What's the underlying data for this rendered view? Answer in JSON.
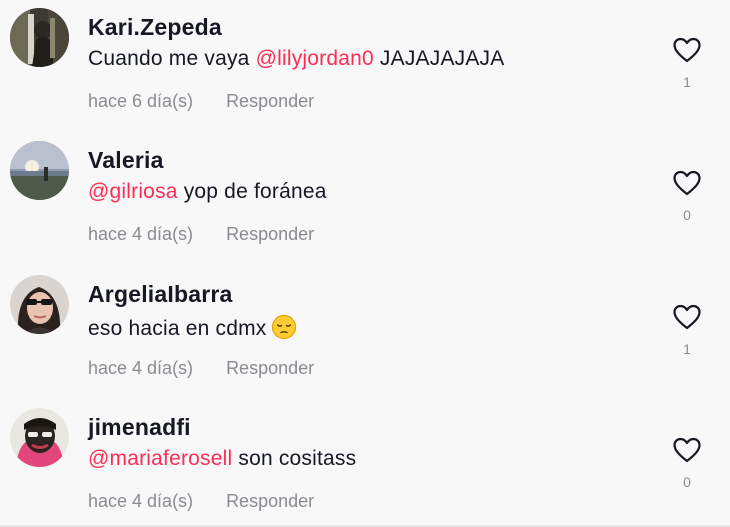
{
  "comments": [
    {
      "username": "Kari.Zepeda",
      "text_before": "Cuando me vaya ",
      "mention": "@lilyjordan0",
      "text_after": " JAJAJAJAJA",
      "time": "hace 6 día(s)",
      "reply_label": "Responder",
      "likes": "1"
    },
    {
      "username": "Valeria",
      "text_before": "",
      "mention": "@gilriosa",
      "text_after": " yop de foránea",
      "time": "hace 4 día(s)",
      "reply_label": "Responder",
      "likes": "0"
    },
    {
      "username": "ArgeliaIbarra",
      "text_before": "eso hacia en cdmx",
      "mention": "",
      "text_after": "",
      "emoji": "pensive-face-emoji",
      "time": "hace 4 día(s)",
      "reply_label": "Responder",
      "likes": "1"
    },
    {
      "username": "jimenadfi",
      "text_before": "",
      "mention": "@mariaferosell",
      "text_after": " son cositass",
      "time": "hace 4 día(s)",
      "reply_label": "Responder",
      "likes": "0"
    }
  ],
  "colors": {
    "mention": "#fe2c55",
    "muted": "#8a8b91",
    "text": "#161823",
    "background": "#f8f8f8"
  },
  "icons": {
    "like": "heart-outline-icon"
  }
}
